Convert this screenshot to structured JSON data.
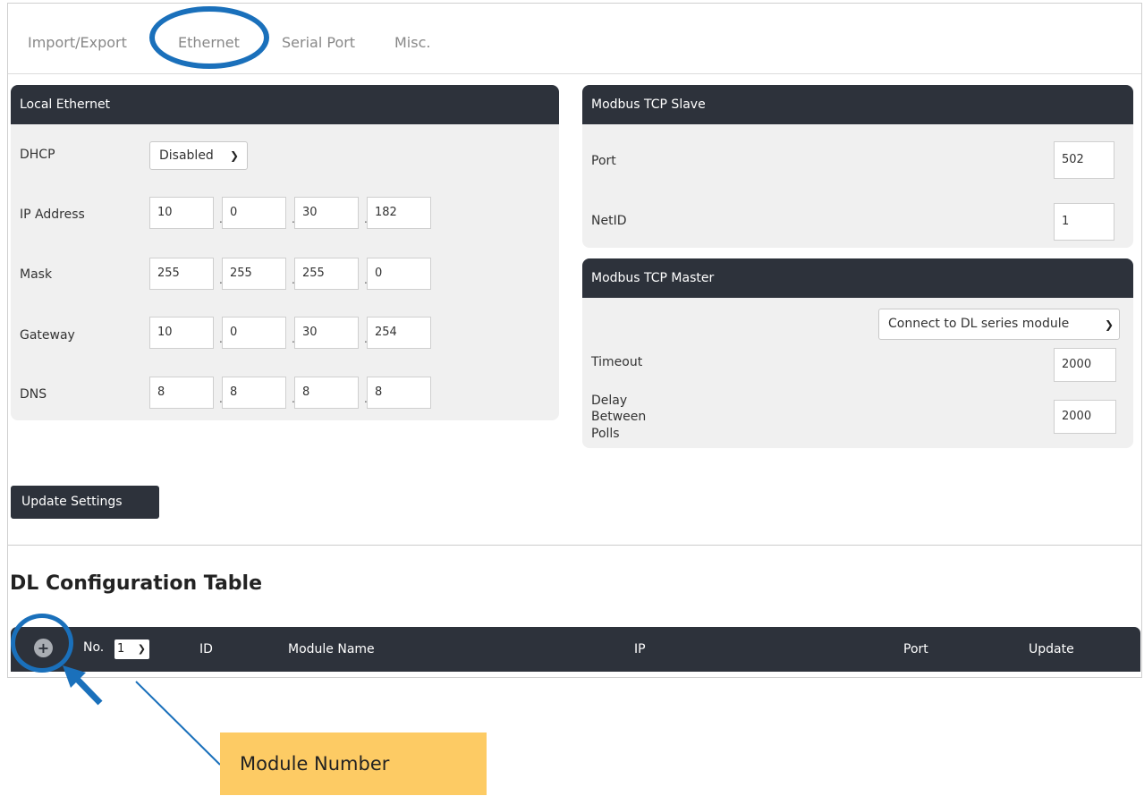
{
  "tabs": [
    {
      "label": "Import/Export"
    },
    {
      "label": "Ethernet"
    },
    {
      "label": "Serial Port"
    },
    {
      "label": "Misc."
    }
  ],
  "local_ethernet": {
    "title": "Local Ethernet",
    "dhcp_label": "DHCP",
    "dhcp_value": "Disabled",
    "ip_label": "IP Address",
    "ip": [
      "10",
      "0",
      "30",
      "182"
    ],
    "mask_label": "Mask",
    "mask": [
      "255",
      "255",
      "255",
      "0"
    ],
    "gateway_label": "Gateway",
    "gateway": [
      "10",
      "0",
      "30",
      "254"
    ],
    "dns_label": "DNS",
    "dns": [
      "8",
      "8",
      "8",
      "8"
    ]
  },
  "tcp_slave": {
    "title": "Modbus TCP Slave",
    "port_label": "Port",
    "port_value": "502",
    "netid_label": "NetID",
    "netid_value": "1"
  },
  "tcp_master": {
    "title": "Modbus TCP Master",
    "mode_value": "Connect to DL series module",
    "timeout_label": "Timeout",
    "timeout_value": "2000",
    "delay_label_1": "Delay",
    "delay_label_2": "Between",
    "delay_label_3": "Polls",
    "delay_value": "2000"
  },
  "update_button": "Update Settings",
  "dl_table": {
    "title": "DL Configuration Table",
    "add_icon": "plus-circle-icon",
    "no_label": "No.",
    "no_value": "1",
    "columns": {
      "id": "ID",
      "module_name": "Module Name",
      "ip": "IP",
      "port": "Port",
      "update": "Update"
    }
  },
  "annotation": {
    "label": "Module Number",
    "highlight_color": "#1a70bb",
    "callout_color": "#fdcb64"
  }
}
